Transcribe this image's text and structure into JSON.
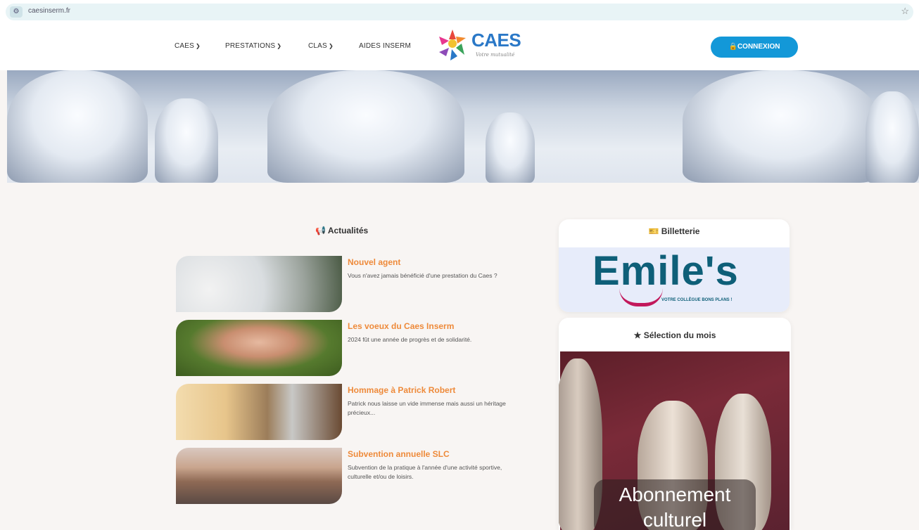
{
  "browser": {
    "url": "caesinserm.fr"
  },
  "nav": {
    "items": [
      {
        "label": "CAES"
      },
      {
        "label": "PRESTATIONS"
      },
      {
        "label": "CLAS"
      },
      {
        "label": "AIDES INSERM"
      }
    ],
    "logo_text": "CAES",
    "logo_tag": "Votre mutualité",
    "login_label": "CONNEXION"
  },
  "news": {
    "section_title": "Actualités",
    "items": [
      {
        "title": "Nouvel agent",
        "desc": "Vous n'avez jamais bénéficié d'une prestation du Caes ?"
      },
      {
        "title": "Les voeux du Caes Inserm",
        "desc": "2024 fût une année de progrès et de solidarité."
      },
      {
        "title": "Hommage à Patrick Robert",
        "desc": "Patrick nous laisse un vide immense mais aussi un héritage précieux..."
      },
      {
        "title": "Subvention annuelle SLC",
        "desc": "Subvention de la pratique à l'année d'une activité sportive, culturelle et/ou de loisirs."
      }
    ]
  },
  "billetterie": {
    "title": "Billetterie",
    "brand": "Emile's",
    "tagline": "VOTRE COLLÈGUE BONS PLANS !"
  },
  "selection": {
    "title": "Sélection du mois",
    "label": "Abonnement culturel"
  },
  "colors": {
    "accent_orange": "#ee8a3a",
    "brand_blue": "#1398d8",
    "emiles_teal": "#0e5f78"
  }
}
